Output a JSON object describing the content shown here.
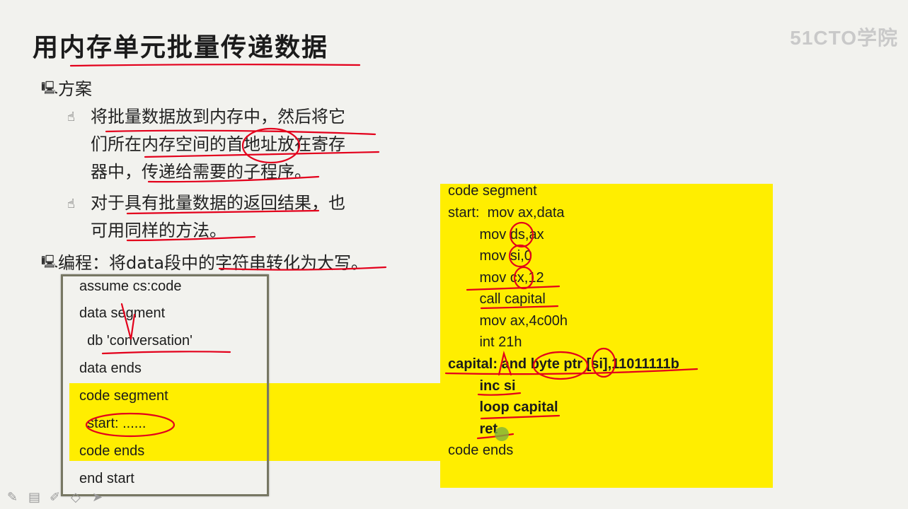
{
  "title": "用内存单元批量传递数据",
  "watermark": "51CTO学院",
  "bullets": {
    "plan_label": "方案",
    "plan_sub1_l1": "将批量数据放到内存中，然后将它",
    "plan_sub1_l2": "们所在内存空间的首地址放在寄存",
    "plan_sub1_l3": "器中，传递给需要的子程序。",
    "plan_sub2_l1": "对于具有批量数据的返回结果，也",
    "plan_sub2_l2": "可用同样的方法。",
    "prog_label": "编程：将data段中的字符串转化为大写。"
  },
  "left_code": [
    "assume cs:code",
    "data segment",
    "  db 'conversation'",
    "data ends",
    "code segment",
    "  start: ......",
    "code ends",
    "end start"
  ],
  "right_code": [
    "code segment",
    "start:  mov ax,data",
    "        mov ds,ax",
    "        mov si,0",
    "        mov cx,12",
    "        call capital",
    "        mov ax,4c00h",
    "        int 21h",
    "capital: and byte ptr [si],11011111b",
    "        inc si",
    "        loop capital",
    "        ret",
    "code ends"
  ],
  "colors": {
    "highlight": "#ffee00",
    "ink": "#e3001b"
  },
  "icons": [
    "monitor-bullet-icon",
    "hand-bullet-icon",
    "pen-tool-icon",
    "eraser-tool-icon"
  ]
}
